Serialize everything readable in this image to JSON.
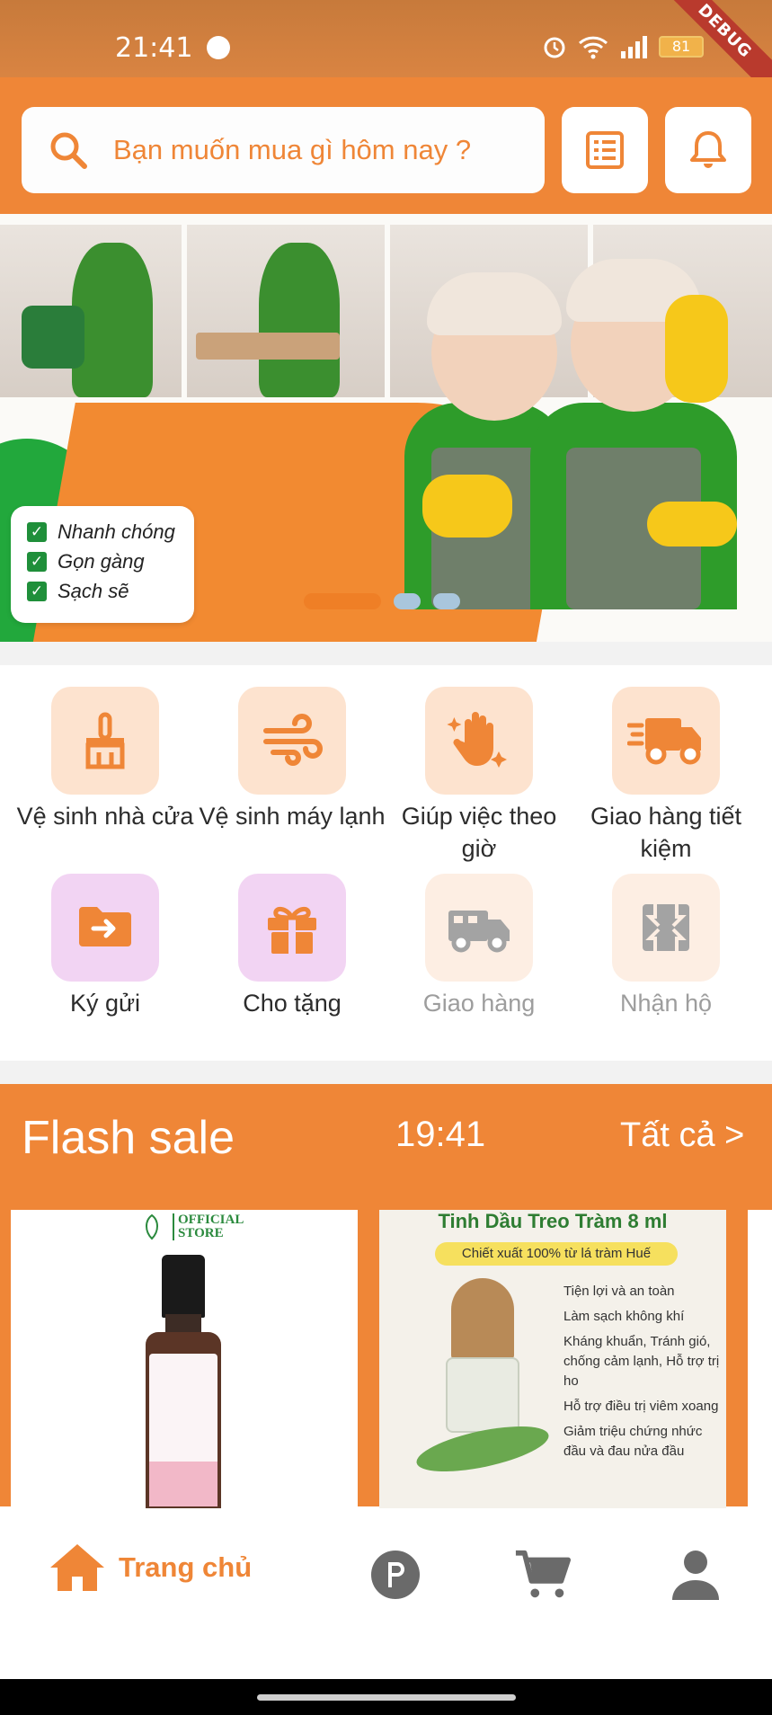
{
  "status_bar": {
    "time": "21:41",
    "battery": "81",
    "debug_label": "DEBUG",
    "icons": [
      "messenger-icon",
      "alarm-icon",
      "wifi-icon",
      "signal-icon",
      "battery-icon"
    ]
  },
  "header": {
    "search_placeholder": "Bạn muốn mua gì hôm nay ?",
    "icons": [
      "search-icon",
      "list-icon",
      "bell-icon"
    ],
    "accent_color": "#ef8637"
  },
  "banner": {
    "checklist": [
      "Nhanh chóng",
      "Gọn gàng",
      "Sạch sẽ"
    ],
    "slide_count": 3,
    "active_slide": 1
  },
  "services": [
    {
      "label": "Vệ sinh nhà cửa",
      "icon": "broom-icon",
      "enabled": true
    },
    {
      "label": "Vệ sinh máy lạnh",
      "icon": "wind-icon",
      "enabled": true
    },
    {
      "label": "Giúp việc theo giờ",
      "icon": "hand-sparkle-icon",
      "enabled": true
    },
    {
      "label": "Giao hàng tiết kiệm",
      "icon": "delivery-truck-icon",
      "enabled": true
    },
    {
      "label": "Ký gửi",
      "icon": "folder-arrow-icon",
      "enabled": true
    },
    {
      "label": "Cho tặng",
      "icon": "gift-icon",
      "enabled": true
    },
    {
      "label": "Giao hàng",
      "icon": "truck-icon",
      "enabled": false
    },
    {
      "label": "Nhận hộ",
      "icon": "package-icon",
      "enabled": false
    }
  ],
  "flash_sale": {
    "title": "Flash sale",
    "countdown": "19:41",
    "see_all": "Tất cả >",
    "products": [
      {
        "store_badge_line1": "OFFICIAL",
        "store_badge_line2": "STORE"
      },
      {
        "title": "Tinh Dầu Treo Tràm 8 ml",
        "subtitle": "Chiết xuất 100% từ lá tràm Huế",
        "features": [
          "Tiện lợi và an toàn",
          "Làm sạch không khí",
          "Kháng khuẩn, Tránh gió, chống cảm lạnh, Hỗ trợ trị ho",
          "Hỗ trợ điều trị viêm xoang",
          "Giảm triệu chứng nhức đầu và đau nửa đầu"
        ]
      }
    ]
  },
  "bottom_nav": {
    "home_label": "Trang chủ",
    "items": [
      "home-icon",
      "points-icon",
      "cart-icon",
      "user-icon"
    ]
  }
}
